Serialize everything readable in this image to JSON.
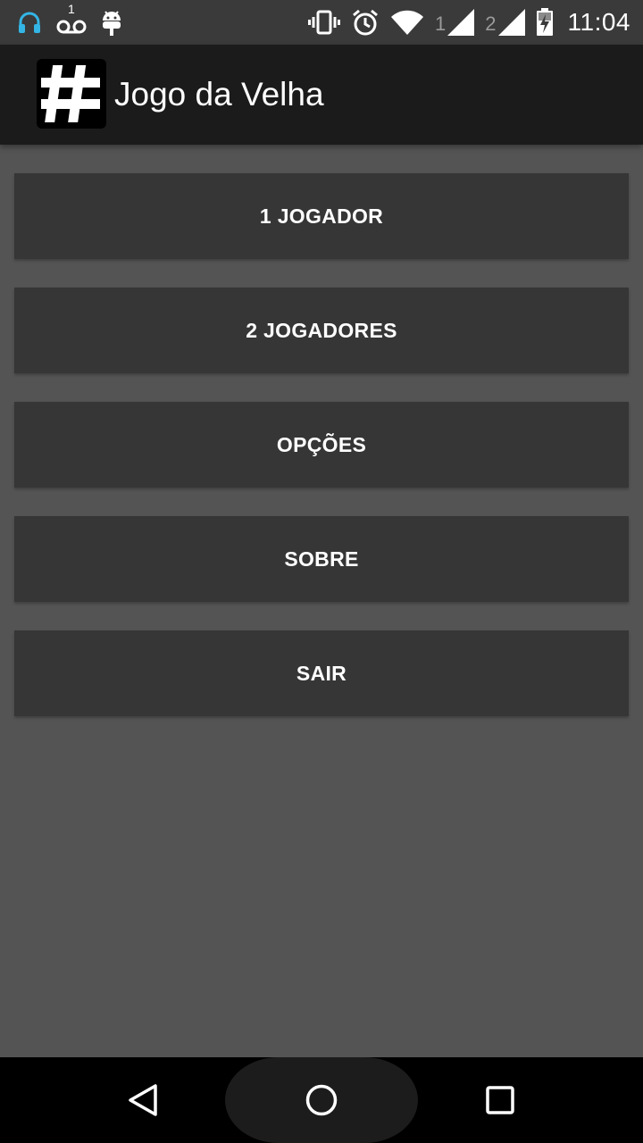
{
  "status_bar": {
    "time": "11:04",
    "sim1_label": "1",
    "sim2_label": "2",
    "voicemail_count": "1",
    "left_icons": [
      "headset-icon",
      "voicemail-icon",
      "android-debug-icon"
    ],
    "right_icons": [
      "vibrate-icon",
      "alarm-icon",
      "wifi-icon",
      "signal-1-icon",
      "signal-2-icon",
      "battery-charging-icon"
    ]
  },
  "action_bar": {
    "title": "Jogo da Velha",
    "icon": "hash-icon"
  },
  "menu": {
    "items": [
      {
        "label": "1 JOGADOR"
      },
      {
        "label": "2 JOGADORES"
      },
      {
        "label": "OPÇÕES"
      },
      {
        "label": "SOBRE"
      },
      {
        "label": "SAIR"
      }
    ]
  },
  "nav_bar": {
    "icons": [
      "back-icon",
      "home-icon",
      "recents-icon"
    ]
  },
  "colors": {
    "background": "#545454",
    "button": "#363636",
    "action_bar": "#1b1b1b",
    "status_bar": "#3a3a3a",
    "nav_bar": "#000000",
    "accent_headset": "#33b5e5"
  }
}
